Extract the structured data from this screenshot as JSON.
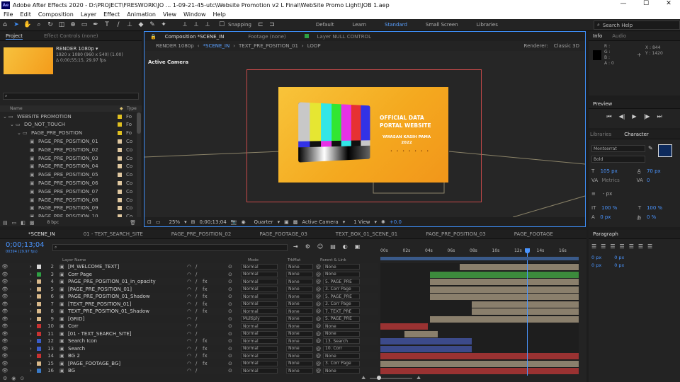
{
  "titlebar": {
    "text": "Adobe After Effects 2020 - D:\\PROJECT\\FRESWORK\\JO ... 1-09-21-45-utc\\Website Promotion v2 L Final\\WebSite Promo Light\\JOB 1.aep",
    "app_icon": "Ae"
  },
  "menu": [
    "File",
    "Edit",
    "Composition",
    "Layer",
    "Effect",
    "Animation",
    "View",
    "Window",
    "Help"
  ],
  "toolbar": {
    "snapping": "Snapping",
    "workspaces": [
      "Default",
      "Learn",
      "Standard",
      "Small Screen",
      "Libraries"
    ],
    "active_workspace": "Standard",
    "search_help": "Search Help"
  },
  "project": {
    "tab": "Project",
    "tab2": "Effect Controls (none)",
    "item_name": "RENDER 1080p ▾",
    "item_res": "1920 x 1080  (960 x 540) (1.00)",
    "item_dur": "Δ 0;00;55;15, 29.97 fps",
    "col_name": "Name",
    "col_type": "Type",
    "items": [
      {
        "name": "WEBSITE PROMOTION",
        "type": "Fo",
        "indent": 0,
        "folder": true
      },
      {
        "name": "DO_NOT_TOUCH",
        "type": "Fo",
        "indent": 1,
        "folder": true
      },
      {
        "name": "PAGE_PRE_POSITION",
        "type": "Fo",
        "indent": 2,
        "folder": true
      },
      {
        "name": "PAGE_PRE_POSITION_01",
        "type": "Co",
        "indent": 3,
        "folder": false
      },
      {
        "name": "PAGE_PRE_POSITION_02",
        "type": "Co",
        "indent": 3,
        "folder": false
      },
      {
        "name": "PAGE_PRE_POSITION_03",
        "type": "Co",
        "indent": 3,
        "folder": false
      },
      {
        "name": "PAGE_PRE_POSITION_04",
        "type": "Co",
        "indent": 3,
        "folder": false
      },
      {
        "name": "PAGE_PRE_POSITION_05",
        "type": "Co",
        "indent": 3,
        "folder": false
      },
      {
        "name": "PAGE_PRE_POSITION_06",
        "type": "Co",
        "indent": 3,
        "folder": false
      },
      {
        "name": "PAGE_PRE_POSITION_07",
        "type": "Co",
        "indent": 3,
        "folder": false
      },
      {
        "name": "PAGE_PRE_POSITION_08",
        "type": "Co",
        "indent": 3,
        "folder": false
      },
      {
        "name": "PAGE_PRE_POSITION_09",
        "type": "Co",
        "indent": 3,
        "folder": false
      },
      {
        "name": "PAGE_PRE_POSITION_10",
        "type": "Co",
        "indent": 3,
        "folder": false
      }
    ],
    "bpc": "8 bpc"
  },
  "comp": {
    "tab": "Composition *SCENE_IN",
    "footage_tab": "Footage (none)",
    "layer_tab": "Layer  NULL CONTROL",
    "flow": [
      "RENDER 1080p",
      "*SCENE_IN",
      "TEXT_PRE_POSITION_01",
      "LOOP"
    ],
    "renderer": "Renderer:",
    "renderer_val": "Classic 3D",
    "active_camera": "Active Camera",
    "zoom": "25%",
    "timecode": "0;00;13;04",
    "resolution": "Quarter",
    "camera": "Active Camera",
    "views": "1 View",
    "exposure": "+0.0",
    "canvas_title": "OFFICIAL DATA\nPORTAL WEBSITE",
    "canvas_sub": "YAYASAN KASIH PAMA\n2022"
  },
  "info": {
    "tab": "Info",
    "tab2": "Audio",
    "labels": [
      "R :",
      "G :",
      "B :",
      "A : 0"
    ],
    "x": "X : 844",
    "y": "Y : 1420"
  },
  "preview": {
    "tab": "Preview"
  },
  "character": {
    "tab": "Libraries",
    "tab2": "Character",
    "font": "Montserrat",
    "style": "Bold",
    "size": "105 px",
    "leading": "70 px",
    "metrics": "Metrics",
    "tracking": "0",
    "stroke": "- px",
    "vscale": "100 %",
    "hscale": "100 %",
    "baseline": "0 px",
    "tsume": "0 %"
  },
  "paragraph": {
    "tab": "Paragraph",
    "indents": [
      "0 px",
      "0 px",
      "0 px",
      "0 px",
      "0 px"
    ]
  },
  "timeline": {
    "tabs": [
      "*SCENE_IN",
      "01 - TEXT_SEARCH_SITE",
      "PAGE_PRE_POSITION_02",
      "PAGE_FOOTAGE_03",
      "TEXT_BOX_01_SCENE_01",
      "PAGE_PRE_POSITION_03",
      "PAGE_FOOTAGE"
    ],
    "timecode": "0;00;13;04",
    "fps": "00394 (29.97 fps)",
    "headers": {
      "layer": "Layer Name",
      "mode": "Mode",
      "trk": "TrkMat",
      "parent": "Parent & Link"
    },
    "ruler": [
      "00s",
      "02s",
      "04s",
      "06s",
      "08s",
      "10s",
      "12s",
      "14s",
      "16s"
    ],
    "layers": [
      {
        "num": "2",
        "color": "#d9d9d9",
        "name": "[M_WELCOME_TEXT]",
        "mode": "Normal",
        "trk": "None",
        "parent": "None",
        "fx": false,
        "bar": {
          "s": 0.4,
          "e": 1,
          "c": "#8a7f6c"
        }
      },
      {
        "num": "3",
        "color": "#2ea043",
        "name": "Corr Page",
        "mode": "Normal",
        "trk": "None",
        "parent": "None",
        "fx": false,
        "bar": {
          "s": 0.25,
          "e": 1,
          "c": "#3c8a3c"
        }
      },
      {
        "num": "4",
        "color": "#d9b98a",
        "name": "PAGE_PRE_POSITION_01_in_opacity",
        "mode": "Normal",
        "trk": "None",
        "parent": "5. PAGE_PRE",
        "fx": true,
        "bar": {
          "s": 0.25,
          "e": 1,
          "c": "#8a7f6c"
        }
      },
      {
        "num": "5",
        "color": "#d9b98a",
        "name": "[PAGE_PRE_POSITION_01]",
        "mode": "Normal",
        "trk": "None",
        "parent": "3. Corr Page",
        "fx": true,
        "bar": {
          "s": 0.25,
          "e": 1,
          "c": "#8a7f6c"
        }
      },
      {
        "num": "6",
        "color": "#d9b98a",
        "name": "PAGE_PRE_POSITION_01_Shadow",
        "mode": "Normal",
        "trk": "None",
        "parent": "5. PAGE_PRE",
        "fx": true,
        "bar": {
          "s": 0.25,
          "e": 1,
          "c": "#8a7f6c"
        }
      },
      {
        "num": "7",
        "color": "#d9b98a",
        "name": "[TEXT_PRE_POSITION_01]",
        "mode": "Normal",
        "trk": "None",
        "parent": "3. Corr Page",
        "fx": true,
        "bar": {
          "s": 0.46,
          "e": 1,
          "c": "#8a7f6c"
        }
      },
      {
        "num": "8",
        "color": "#d9b98a",
        "name": "TEXT_PRE_POSITION_01_Shadow",
        "mode": "Normal",
        "trk": "None",
        "parent": "7. TEXT_PRE",
        "fx": true,
        "bar": {
          "s": 0.46,
          "e": 1,
          "c": "#8a7f6c"
        }
      },
      {
        "num": "9",
        "color": "#d9b98a",
        "name": "[GRID]",
        "mode": "Multiply",
        "trk": "None",
        "parent": "5. PAGE_PRE",
        "fx": false,
        "bar": {
          "s": 0.25,
          "e": 1,
          "c": "#8a7f6c"
        }
      },
      {
        "num": "10",
        "color": "#c83232",
        "name": "Corr",
        "mode": "Normal",
        "trk": "None",
        "parent": "None",
        "fx": false,
        "bar": {
          "s": 0,
          "e": 0.24,
          "c": "#9a3232"
        }
      },
      {
        "num": "11",
        "color": "#c83232",
        "name": "[01 - TEXT_SEARCH_SITE]",
        "mode": "Normal",
        "trk": "None",
        "parent": "None",
        "fx": false,
        "bar": {
          "s": 0.12,
          "e": 0.29,
          "c": "#8a7f6c"
        }
      },
      {
        "num": "12",
        "color": "#3a5cc8",
        "name": "Search Icon",
        "mode": "Normal",
        "trk": "None",
        "parent": "13. Search",
        "fx": true,
        "bar": {
          "s": 0,
          "e": 0.46,
          "c": "#3c4a8a"
        }
      },
      {
        "num": "13",
        "color": "#3a5cc8",
        "name": "Search",
        "mode": "Normal",
        "trk": "None",
        "parent": "10. Corr",
        "fx": true,
        "bar": {
          "s": 0,
          "e": 0.46,
          "c": "#3c4a8a"
        }
      },
      {
        "num": "14",
        "color": "#c83232",
        "name": "BG 2",
        "mode": "Normal",
        "trk": "None",
        "parent": "None",
        "fx": true,
        "bar": {
          "s": 0,
          "e": 1,
          "c": "#9a3232"
        }
      },
      {
        "num": "15",
        "color": "#d9b98a",
        "name": "[PAGE_FOOTAGE_BG]",
        "mode": "Normal",
        "trk": "None",
        "parent": "3. Corr Page",
        "fx": true,
        "bar": {
          "s": 0,
          "e": 1,
          "c": "#8a7f6c"
        }
      },
      {
        "num": "16",
        "color": "#3a7ac8",
        "name": "BG",
        "mode": "Normal",
        "trk": "None",
        "parent": "None",
        "fx": false,
        "bar": {
          "s": 0,
          "e": 1,
          "c": "#9a3232"
        }
      }
    ]
  },
  "colors": {
    "accent": "#3e8ef7",
    "comp_border": "#e06464",
    "orange": "#f4a020",
    "yellow": "#f0c020"
  }
}
